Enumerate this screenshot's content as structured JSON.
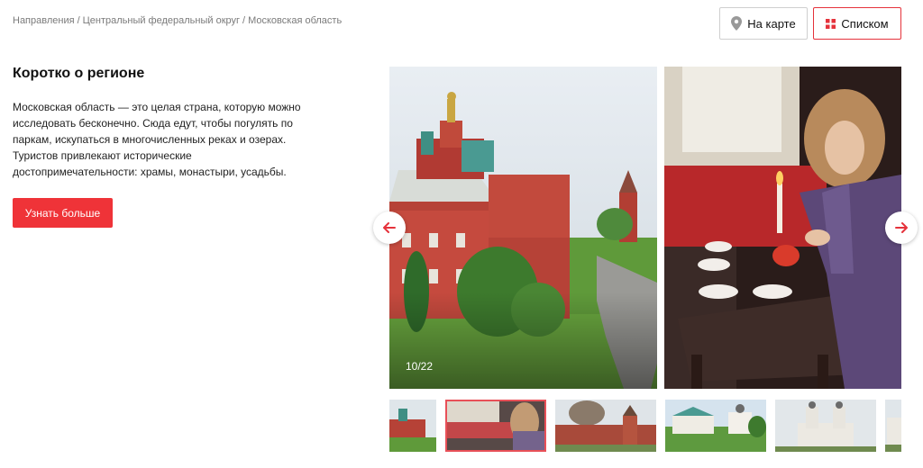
{
  "breadcrumb": {
    "items": [
      "Направления",
      "Центральный федеральный округ",
      "Московская область"
    ],
    "separator": "/"
  },
  "view_toggle": {
    "map_label": "На карте",
    "list_label": "Списком",
    "map_icon": "map-pin-icon",
    "list_icon": "grid-icon",
    "active": "list"
  },
  "region": {
    "title": "Коротко о регионе",
    "description": "Московская область — это целая страна, которую можно исследовать бесконечно. Сюда едут, чтобы погулять по паркам, искупаться в многочисленных реках и озерах. Туристов привлекают исторические достопримечательности: храмы, монастыри, усадьбы.",
    "button_label": "Узнать больше"
  },
  "gallery": {
    "counter": "10/22",
    "prev_icon": "arrow-left-icon",
    "next_icon": "arrow-right-icon",
    "active_thumbnail": 1
  },
  "colors": {
    "accent": "#ef3338",
    "breadcrumb": "#7a7a7a"
  }
}
